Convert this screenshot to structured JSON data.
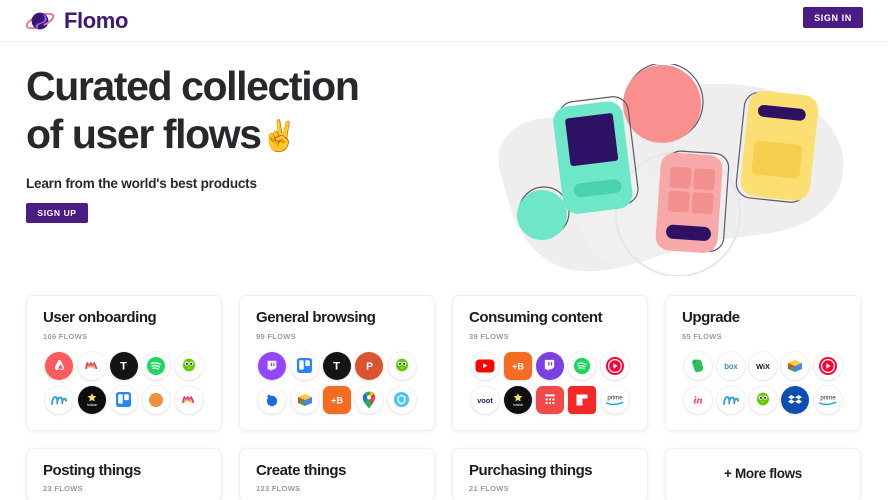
{
  "header": {
    "brand_name": "Flomo",
    "logo_icon": "planet-ring-icon",
    "signin_label": "SIGN IN",
    "brand_color": "#3c1a78",
    "accent_color": "#4b1d84"
  },
  "hero": {
    "title": "Curated collection\nof user flows",
    "title_emoji": "✌️",
    "subtitle": "Learn from the world's best products",
    "signup_label": "SIGN UP",
    "illustration": {
      "name": "user-flow-phones-illustration",
      "blob_color": "#eeeeef",
      "cards": [
        {
          "name": "teal-phone-card",
          "color": "#6ee7c8",
          "accent": "#2e1065"
        },
        {
          "name": "pink-phone-card",
          "color": "#f7a8a8",
          "accent": "#2e1065"
        },
        {
          "name": "yellow-phone-card",
          "color": "#fbdf72",
          "accent": "#2e1065"
        }
      ],
      "circles": [
        {
          "name": "pink-circle",
          "color": "#fa8f8f"
        },
        {
          "name": "mint-circle",
          "color": "#6ee7c8"
        }
      ]
    }
  },
  "categories": [
    {
      "title": "User onboarding",
      "flows": "106 FLOWS",
      "icons": [
        "airbnb-icon",
        "myntra-icon",
        "tinder-icon",
        "spotify-icon",
        "duolingo-icon",
        "mailchimp-icon",
        "hotstar-icon",
        "trello-icon",
        "orange-circle-icon",
        "myntra-icon"
      ]
    },
    {
      "title": "General browsing",
      "flows": "99 FLOWS",
      "icons": [
        "twitch-icon",
        "trello-icon",
        "tinder-icon",
        "producthunt-icon",
        "duolingo-icon",
        "blue-dot-icon",
        "colorfold-icon",
        "plusb-icon",
        "google-maps-icon",
        "shield-icon"
      ]
    },
    {
      "title": "Consuming content",
      "flows": "39 FLOWS",
      "icons": [
        "youtube-icon",
        "plusb-icon",
        "twitch-icon",
        "spotify-icon",
        "youtube-music-icon",
        "voot-icon",
        "hotstar-icon",
        "red-grid-icon",
        "flipboard-icon",
        "prime-icon"
      ]
    },
    {
      "title": "Upgrade",
      "flows": "55 FLOWS",
      "icons": [
        "evernote-icon",
        "box-icon",
        "wix-icon",
        "colorfold-icon",
        "youtube-music-icon",
        "invision-icon",
        "mailchimp-icon",
        "duolingo-icon",
        "dropbox-icon",
        "prime-icon"
      ]
    },
    {
      "title": "Posting things",
      "flows": "23 FLOWS",
      "icons": []
    },
    {
      "title": "Create things",
      "flows": "123 FLOWS",
      "icons": []
    },
    {
      "title": "Purchasing things",
      "flows": "21 FLOWS",
      "icons": []
    }
  ],
  "more_card": {
    "label": "+ More flows"
  }
}
